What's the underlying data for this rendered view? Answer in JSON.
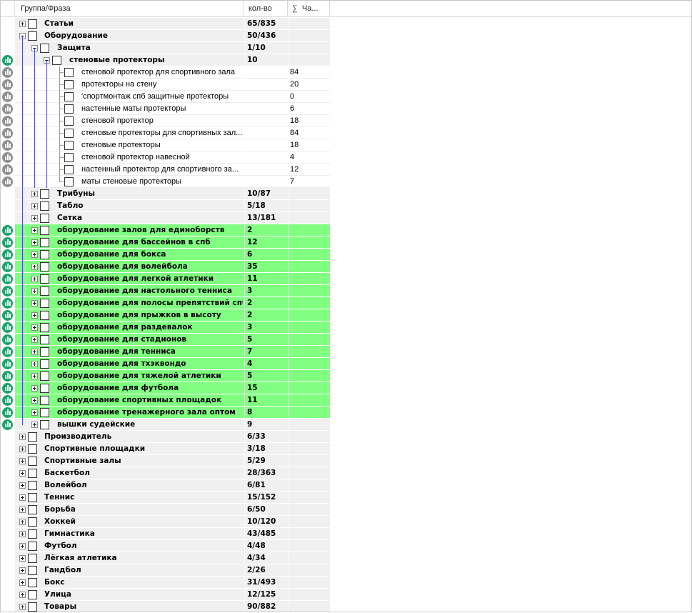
{
  "header": {
    "group_label": "Группа/Фраза",
    "count_label": "кол-во",
    "sigma_glyph": "∑",
    "freq_label": "Ча..."
  },
  "colors": {
    "green_row": "#80ff80",
    "grey_row": "#f0f0f0",
    "stat_green": "#1ea36a",
    "stat_grey": "#909090",
    "tree_line": "#4a4ae0"
  },
  "rows": [
    {
      "name": "Статьи",
      "count": "65/835",
      "freq": "",
      "level": 1,
      "exp": "plus",
      "style": "grey",
      "icon": ""
    },
    {
      "name": "Оборудование",
      "count": "50/436",
      "freq": "",
      "level": 1,
      "exp": "minus",
      "style": "grey",
      "icon": ""
    },
    {
      "name": "Защита",
      "count": "1/10",
      "freq": "",
      "level": 2,
      "exp": "minus",
      "style": "grey",
      "icon": ""
    },
    {
      "name": "стеновые протекторы",
      "count": "10",
      "freq": "",
      "level": 3,
      "exp": "minus",
      "style": "grey",
      "icon": "green"
    },
    {
      "name": "стеновой протектор для спортивного зала",
      "count": "",
      "freq": "84",
      "level": 4,
      "exp": "",
      "style": "white",
      "icon": "grey"
    },
    {
      "name": "протекторы на стену",
      "count": "",
      "freq": "20",
      "level": 4,
      "exp": "",
      "style": "white",
      "icon": "grey"
    },
    {
      "name": "'спортмонтаж спб защитные протекторы",
      "count": "",
      "freq": "0",
      "level": 4,
      "exp": "",
      "style": "white",
      "icon": "grey"
    },
    {
      "name": "настенные маты протекторы",
      "count": "",
      "freq": "6",
      "level": 4,
      "exp": "",
      "style": "white",
      "icon": "grey"
    },
    {
      "name": "стеновой протектор",
      "count": "",
      "freq": "18",
      "level": 4,
      "exp": "",
      "style": "white",
      "icon": "grey"
    },
    {
      "name": "стеновые протекторы для спортивных зал...",
      "count": "",
      "freq": "84",
      "level": 4,
      "exp": "",
      "style": "white",
      "icon": "grey"
    },
    {
      "name": "стеновые протекторы",
      "count": "",
      "freq": "18",
      "level": 4,
      "exp": "",
      "style": "white",
      "icon": "grey"
    },
    {
      "name": "стеновой протектор навесной",
      "count": "",
      "freq": "4",
      "level": 4,
      "exp": "",
      "style": "white",
      "icon": "grey"
    },
    {
      "name": "настенный протектор для спортивного за...",
      "count": "",
      "freq": "12",
      "level": 4,
      "exp": "",
      "style": "white",
      "icon": "grey"
    },
    {
      "name": "маты стеновые протекторы",
      "count": "",
      "freq": "7",
      "level": 4,
      "exp": "",
      "style": "white",
      "icon": "grey"
    },
    {
      "name": "Трибуны",
      "count": "10/87",
      "freq": "",
      "level": 2,
      "exp": "plus",
      "style": "grey",
      "icon": ""
    },
    {
      "name": "Табло",
      "count": "5/18",
      "freq": "",
      "level": 2,
      "exp": "plus",
      "style": "grey",
      "icon": ""
    },
    {
      "name": "Сетка",
      "count": "13/181",
      "freq": "",
      "level": 2,
      "exp": "plus",
      "style": "grey",
      "icon": ""
    },
    {
      "name": "оборудование залов для единоборств",
      "count": "2",
      "freq": "",
      "level": 2,
      "exp": "plus",
      "style": "green",
      "icon": "green"
    },
    {
      "name": "оборудование для бассейнов в спб",
      "count": "12",
      "freq": "",
      "level": 2,
      "exp": "plus",
      "style": "green",
      "icon": "green"
    },
    {
      "name": "оборудование для бокса",
      "count": "6",
      "freq": "",
      "level": 2,
      "exp": "plus",
      "style": "green",
      "icon": "green"
    },
    {
      "name": "оборудование для волейбола",
      "count": "35",
      "freq": "",
      "level": 2,
      "exp": "plus",
      "style": "green",
      "icon": "green"
    },
    {
      "name": "оборудование для легкой атлетики",
      "count": "11",
      "freq": "",
      "level": 2,
      "exp": "plus",
      "style": "green",
      "icon": "green"
    },
    {
      "name": "оборудование для настольного тенниса",
      "count": "3",
      "freq": "",
      "level": 2,
      "exp": "plus",
      "style": "green",
      "icon": "green"
    },
    {
      "name": "оборудование для полосы препятствий спб",
      "count": "2",
      "freq": "",
      "level": 2,
      "exp": "plus",
      "style": "green",
      "icon": "green"
    },
    {
      "name": "оборудование для прыжков в высоту",
      "count": "2",
      "freq": "",
      "level": 2,
      "exp": "plus",
      "style": "green",
      "icon": "green"
    },
    {
      "name": "оборудование для раздевалок",
      "count": "3",
      "freq": "",
      "level": 2,
      "exp": "plus",
      "style": "green",
      "icon": "green"
    },
    {
      "name": "оборудование для стадионов",
      "count": "5",
      "freq": "",
      "level": 2,
      "exp": "plus",
      "style": "green",
      "icon": "green"
    },
    {
      "name": "оборудование для тенниса",
      "count": "7",
      "freq": "",
      "level": 2,
      "exp": "plus",
      "style": "green",
      "icon": "green"
    },
    {
      "name": "оборудование для тхэквондо",
      "count": "4",
      "freq": "",
      "level": 2,
      "exp": "plus",
      "style": "green",
      "icon": "green"
    },
    {
      "name": "оборудование для тяжелой атлетики",
      "count": "5",
      "freq": "",
      "level": 2,
      "exp": "plus",
      "style": "green",
      "icon": "green"
    },
    {
      "name": "оборудование для футбола",
      "count": "15",
      "freq": "",
      "level": 2,
      "exp": "plus",
      "style": "green",
      "icon": "green"
    },
    {
      "name": "оборудование спортивных площадок",
      "count": "11",
      "freq": "",
      "level": 2,
      "exp": "plus",
      "style": "green",
      "icon": "green"
    },
    {
      "name": "оборудование тренажерного зала оптом",
      "count": "8",
      "freq": "",
      "level": 2,
      "exp": "plus",
      "style": "green",
      "icon": "green"
    },
    {
      "name": "вышки судейские",
      "count": "9",
      "freq": "",
      "level": 2,
      "exp": "plus",
      "style": "grey",
      "icon": "green"
    },
    {
      "name": "Производитель",
      "count": "6/33",
      "freq": "",
      "level": 1,
      "exp": "plus",
      "style": "grey",
      "icon": ""
    },
    {
      "name": "Спортивные площадки",
      "count": "3/18",
      "freq": "",
      "level": 1,
      "exp": "plus",
      "style": "grey",
      "icon": ""
    },
    {
      "name": "Спортивные залы",
      "count": "5/29",
      "freq": "",
      "level": 1,
      "exp": "plus",
      "style": "grey",
      "icon": ""
    },
    {
      "name": "Баскетбол",
      "count": "28/363",
      "freq": "",
      "level": 1,
      "exp": "plus",
      "style": "grey",
      "icon": ""
    },
    {
      "name": "Волейбол",
      "count": "6/81",
      "freq": "",
      "level": 1,
      "exp": "plus",
      "style": "grey",
      "icon": ""
    },
    {
      "name": "Теннис",
      "count": "15/152",
      "freq": "",
      "level": 1,
      "exp": "plus",
      "style": "grey",
      "icon": ""
    },
    {
      "name": "Борьба",
      "count": "6/50",
      "freq": "",
      "level": 1,
      "exp": "plus",
      "style": "grey",
      "icon": ""
    },
    {
      "name": "Хоккей",
      "count": "10/120",
      "freq": "",
      "level": 1,
      "exp": "plus",
      "style": "grey",
      "icon": ""
    },
    {
      "name": "Гимнастика",
      "count": "43/485",
      "freq": "",
      "level": 1,
      "exp": "plus",
      "style": "grey",
      "icon": ""
    },
    {
      "name": "Футбол",
      "count": "4/48",
      "freq": "",
      "level": 1,
      "exp": "plus",
      "style": "grey",
      "icon": ""
    },
    {
      "name": "Лёгкая атлетика",
      "count": "4/34",
      "freq": "",
      "level": 1,
      "exp": "plus",
      "style": "grey",
      "icon": ""
    },
    {
      "name": "Гандбол",
      "count": "2/26",
      "freq": "",
      "level": 1,
      "exp": "plus",
      "style": "grey",
      "icon": ""
    },
    {
      "name": "Бокс",
      "count": "31/493",
      "freq": "",
      "level": 1,
      "exp": "plus",
      "style": "grey",
      "icon": ""
    },
    {
      "name": "Улица",
      "count": "12/125",
      "freq": "",
      "level": 1,
      "exp": "plus",
      "style": "grey",
      "icon": ""
    },
    {
      "name": "Товары",
      "count": "90/882",
      "freq": "",
      "level": 1,
      "exp": "plus",
      "style": "grey",
      "icon": ""
    }
  ]
}
